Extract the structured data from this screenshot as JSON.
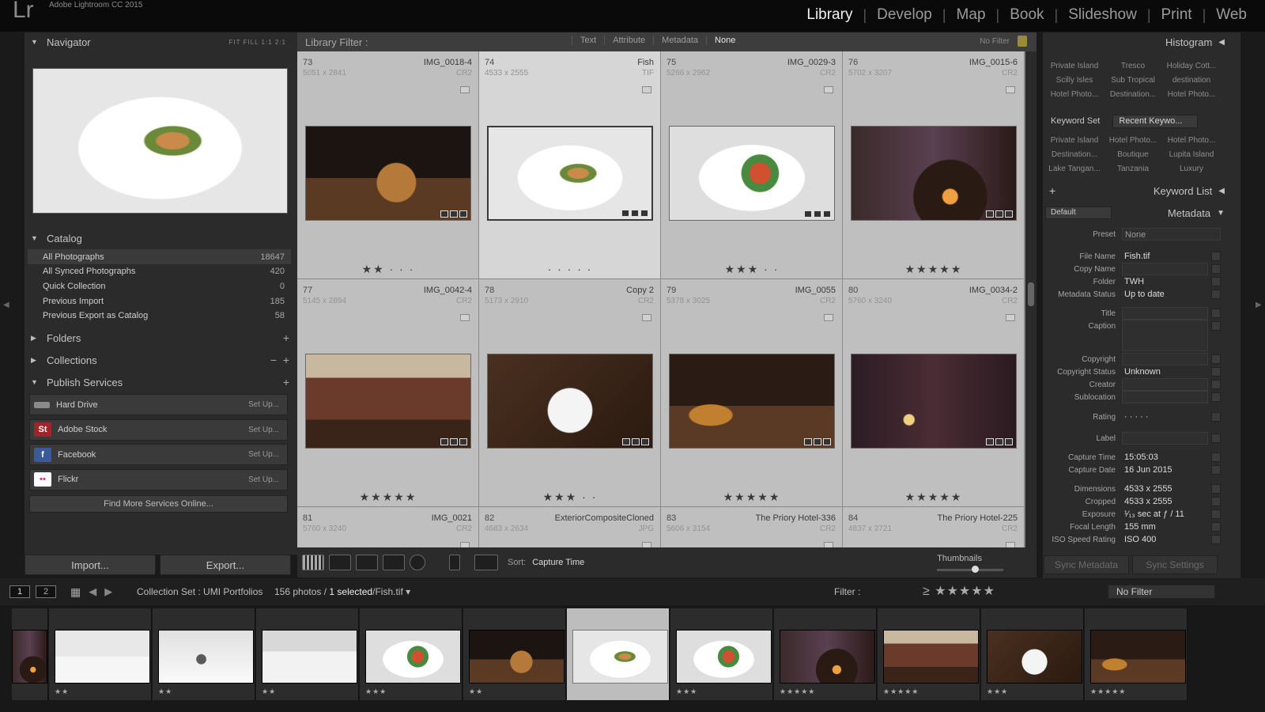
{
  "app": {
    "name": "Adobe Lightroom CC 2015",
    "logo": "Lr"
  },
  "modules": [
    "Library",
    "Develop",
    "Map",
    "Book",
    "Slideshow",
    "Print",
    "Web"
  ],
  "active_module": "Library",
  "navigator": {
    "title": "Navigator",
    "zoom": "FIT  FILL  1:1  2:1"
  },
  "catalog": {
    "title": "Catalog",
    "items": [
      {
        "label": "All Photographs",
        "count": "18647"
      },
      {
        "label": "All Synced Photographs",
        "count": "420"
      },
      {
        "label": "Quick Collection",
        "count": "0"
      },
      {
        "label": "Previous Import",
        "count": "185"
      },
      {
        "label": "Previous Export as Catalog",
        "count": "58"
      }
    ]
  },
  "folders": {
    "title": "Folders"
  },
  "collections": {
    "title": "Collections"
  },
  "publish": {
    "title": "Publish Services",
    "services": [
      {
        "label": "Hard Drive",
        "setup": "Set Up...",
        "icon": "hard-drive-icon",
        "glyph": "",
        "color": "#7a7a7a"
      },
      {
        "label": "Adobe Stock",
        "setup": "Set Up...",
        "icon": "adobe-stock-icon",
        "glyph": "St",
        "color": "#a32428"
      },
      {
        "label": "Facebook",
        "setup": "Set Up...",
        "icon": "facebook-icon",
        "glyph": "f",
        "color": "#3b5a9a"
      },
      {
        "label": "Flickr",
        "setup": "Set Up...",
        "icon": "flickr-icon",
        "glyph": "••",
        "color": "#ffffff"
      }
    ],
    "find_more": "Find More Services Online..."
  },
  "import_label": "Import...",
  "export_label": "Export...",
  "library_filter": {
    "label": "Library Filter :",
    "options": [
      "Text",
      "Attribute",
      "Metadata",
      "None"
    ],
    "active": "None",
    "right": "No Filter"
  },
  "grid": [
    {
      "num": "73",
      "file": "IMG_0018-4",
      "dims": "5051 x 2841",
      "ext": "CR2",
      "stars": "★★ · · ·",
      "scene": "burger"
    },
    {
      "num": "74",
      "file": "Fish",
      "dims": "4533 x 2555",
      "ext": "TIF",
      "stars": "· · · · ·",
      "scene": "plate-fish",
      "selected": true
    },
    {
      "num": "75",
      "file": "IMG_0029-3",
      "dims": "5266 x 2962",
      "ext": "CR2",
      "stars": "★★★ · ·",
      "scene": "plate-salad"
    },
    {
      "num": "76",
      "file": "IMG_0015-6",
      "dims": "5702 x 3207",
      "ext": "CR2",
      "stars": "★★★★★",
      "scene": "fireplace"
    },
    {
      "num": "77",
      "file": "IMG_0042-4",
      "dims": "5145 x 2894",
      "ext": "CR2",
      "stars": "★★★★★",
      "scene": "dining"
    },
    {
      "num": "78",
      "file": "Copy 2",
      "dims": "5173 x 2910",
      "ext": "CR2",
      "stars": "★★★ · ·",
      "scene": "breakfast"
    },
    {
      "num": "79",
      "file": "IMG_0055",
      "dims": "5378 x 3025",
      "ext": "CR2",
      "stars": "★★★★★",
      "scene": "beer"
    },
    {
      "num": "80",
      "file": "IMG_0034-2",
      "dims": "5760 x 3240",
      "ext": "CR2",
      "stars": "★★★★★",
      "scene": "candle"
    },
    {
      "num": "81",
      "file": "IMG_0021",
      "dims": "5760 x 3240",
      "ext": "CR2",
      "stars": "",
      "scene": ""
    },
    {
      "num": "82",
      "file": "ExteriorCompositeCloned",
      "dims": "4683 x 2634",
      "ext": "JPG",
      "stars": "",
      "scene": ""
    },
    {
      "num": "83",
      "file": "The Priory Hotel-336",
      "dims": "5606 x 3154",
      "ext": "CR2",
      "stars": "",
      "scene": ""
    },
    {
      "num": "84",
      "file": "The Priory Hotel-225",
      "dims": "4837 x 2721",
      "ext": "CR2",
      "stars": "",
      "scene": ""
    }
  ],
  "toolbar": {
    "sort_label": "Sort:",
    "sort_value": "Capture Time",
    "thumbnails_label": "Thumbnails"
  },
  "right_panel": {
    "histogram": "Histogram",
    "suggested_keywords": [
      "Private Island",
      "Tresco",
      "Holiday Cott...",
      "Scilly Isles",
      "Sub Tropical",
      "destination",
      "Hotel Photo...",
      "Destination...",
      "Hotel Photo..."
    ],
    "keyword_set_label": "Keyword Set",
    "keyword_set_value": "Recent Keywo...",
    "keyword_set_items": [
      "Private Island",
      "Hotel Photo...",
      "Hotel Photo...",
      "Destination...",
      "Boutique",
      "Lupita Island",
      "Lake Tangan...",
      "Tanzania",
      "Luxury"
    ],
    "keyword_list": "Keyword List",
    "metadata_title": "Metadata",
    "metadata_preset_select": "Default",
    "preset_label": "Preset",
    "preset_value": "None",
    "fields": [
      {
        "k": "File Name",
        "v": "Fish.tif"
      },
      {
        "k": "Copy Name",
        "v": ""
      },
      {
        "k": "Folder",
        "v": "TWH"
      },
      {
        "k": "Metadata Status",
        "v": "Up to date"
      },
      {
        "k": "Title",
        "v": ""
      },
      {
        "k": "Caption",
        "v": ""
      },
      {
        "k": "Copyright",
        "v": ""
      },
      {
        "k": "Copyright Status",
        "v": "Unknown"
      },
      {
        "k": "Creator",
        "v": ""
      },
      {
        "k": "Sublocation",
        "v": ""
      },
      {
        "k": "Rating",
        "v": "· · · · ·"
      },
      {
        "k": "Label",
        "v": ""
      },
      {
        "k": "Capture Time",
        "v": "15:05:03"
      },
      {
        "k": "Capture Date",
        "v": "16 Jun 2015"
      },
      {
        "k": "Dimensions",
        "v": "4533 x 2555"
      },
      {
        "k": "Cropped",
        "v": "4533 x 2555"
      },
      {
        "k": "Exposure",
        "v": "¹⁄₁₃ sec at ƒ / 11"
      },
      {
        "k": "Focal Length",
        "v": "155 mm"
      },
      {
        "k": "ISO Speed Rating",
        "v": "ISO 400"
      }
    ],
    "sync_metadata": "Sync Metadata",
    "sync_settings": "Sync Settings"
  },
  "filmstrip_bar": {
    "page1": "1",
    "page2": "2",
    "source": "Collection Set : UMI Portfolios",
    "count_prefix": "156 photos /",
    "count_selected": "1 selected",
    "count_file": "/Fish.tif",
    "filter_label": "Filter :",
    "rating_filter": "≥ ★★★★★",
    "no_filter": "No Filter"
  },
  "filmstrip": [
    {
      "scene": "fireplace",
      "stars": ""
    },
    {
      "scene": "bath",
      "stars": "★★"
    },
    {
      "scene": "bath2",
      "stars": "★★"
    },
    {
      "scene": "bath3",
      "stars": "★★"
    },
    {
      "scene": "plate-salad",
      "stars": "★★★"
    },
    {
      "scene": "burger",
      "stars": "★★"
    },
    {
      "scene": "plate-fish",
      "stars": "",
      "selected": true
    },
    {
      "scene": "plate-salad",
      "stars": "★★★"
    },
    {
      "scene": "fireplace",
      "stars": "★★★★★"
    },
    {
      "scene": "dining",
      "stars": "★★★★★"
    },
    {
      "scene": "breakfast",
      "stars": "★★★"
    },
    {
      "scene": "beer",
      "stars": "★★★★★"
    }
  ]
}
